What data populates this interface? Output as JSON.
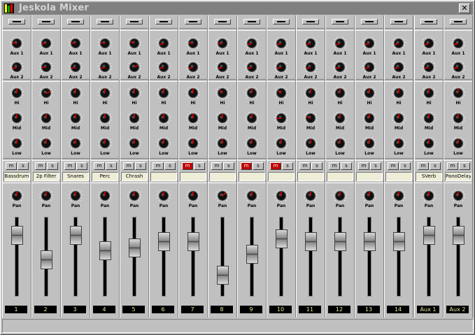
{
  "window": {
    "title": "Jeskola Mixer",
    "close_label": "✕"
  },
  "knob_labels": {
    "aux1": "Aux 1",
    "aux2": "Aux 2",
    "hi": "Hi",
    "mid": "Mid",
    "low": "Low",
    "pan": "Pan"
  },
  "buttons": {
    "mute": "m",
    "solo": "s"
  },
  "channels": [
    {
      "number": "1",
      "name": "Bassdrum",
      "mute": false,
      "aux1": -0.6,
      "aux2": -0.8,
      "hi": 0,
      "mid": 0,
      "low": 0,
      "pan": 0,
      "fader": 0.85
    },
    {
      "number": "2",
      "name": "2p Filter",
      "mute": false,
      "aux1": -0.7,
      "aux2": -0.7,
      "hi": 0.55,
      "mid": 0,
      "low": 0,
      "pan": 0,
      "fader": 0.45
    },
    {
      "number": "3",
      "name": "Snares",
      "mute": false,
      "aux1": -0.6,
      "aux2": -0.8,
      "hi": 0,
      "mid": 0,
      "low": 0,
      "pan": 0,
      "fader": 0.85
    },
    {
      "number": "4",
      "name": "Perc",
      "mute": false,
      "aux1": -0.6,
      "aux2": -0.8,
      "hi": 0,
      "mid": 0,
      "low": 0,
      "pan": 0,
      "fader": 0.6
    },
    {
      "number": "5",
      "name": "Chrash",
      "mute": false,
      "aux1": -0.5,
      "aux2": 0.45,
      "hi": 0,
      "mid": 0,
      "low": 0,
      "pan": 0,
      "fader": 0.65
    },
    {
      "number": "6",
      "name": "",
      "mute": false,
      "aux1": -0.8,
      "aux2": -0.8,
      "hi": 0,
      "mid": 0,
      "low": 0,
      "pan": 0,
      "fader": 0.75
    },
    {
      "number": "7",
      "name": "",
      "mute": true,
      "aux1": -0.6,
      "aux2": -0.8,
      "hi": 0,
      "mid": 0,
      "low": 0,
      "pan": 0,
      "fader": 0.75
    },
    {
      "number": "8",
      "name": "",
      "mute": false,
      "aux1": -0.7,
      "aux2": -0.8,
      "hi": -0.3,
      "mid": 0,
      "low": 0,
      "pan": 0.35,
      "fader": 0.2
    },
    {
      "number": "9",
      "name": "",
      "mute": true,
      "aux1": -0.8,
      "aux2": -0.8,
      "hi": 0,
      "mid": 0,
      "low": 0,
      "pan": 0,
      "fader": 0.55
    },
    {
      "number": "10",
      "name": "",
      "mute": true,
      "aux1": -0.8,
      "aux2": -0.8,
      "hi": -0.4,
      "mid": -0.7,
      "low": 0,
      "pan": 0,
      "fader": 0.8
    },
    {
      "number": "11",
      "name": "",
      "mute": false,
      "aux1": -0.8,
      "aux2": -0.8,
      "hi": 0,
      "mid": -0.5,
      "low": 0,
      "pan": 0,
      "fader": 0.75
    },
    {
      "number": "12",
      "name": "",
      "mute": false,
      "aux1": -0.8,
      "aux2": -0.8,
      "hi": 0,
      "mid": 0,
      "low": 0,
      "pan": 0,
      "fader": 0.75
    },
    {
      "number": "13",
      "name": "",
      "mute": false,
      "aux1": -0.8,
      "aux2": -0.8,
      "hi": 0,
      "mid": 0,
      "low": 0,
      "pan": 0,
      "fader": 0.75
    },
    {
      "number": "14",
      "name": "",
      "mute": false,
      "aux1": -0.8,
      "aux2": -0.8,
      "hi": 0,
      "mid": 0,
      "low": 0,
      "pan": 0,
      "fader": 0.75
    },
    {
      "number": "Aux 1",
      "name": "SVerb",
      "mute": false,
      "aux1": -0.8,
      "aux2": -0.8,
      "hi": 0,
      "mid": 0,
      "low": 0,
      "pan": 0,
      "fader": 0.85
    },
    {
      "number": "Aux 2",
      "name": "PanoDelay",
      "mute": false,
      "aux1": -0.8,
      "aux2": -0.8,
      "hi": 0,
      "mid": 0,
      "low": 0,
      "pan": 0,
      "fader": 0.85
    }
  ],
  "colors": {
    "knob_indicator": "#d00000",
    "mute_active": "#c00000",
    "label_bg": "#eeeed8",
    "number_text": "#e8e8a0"
  }
}
